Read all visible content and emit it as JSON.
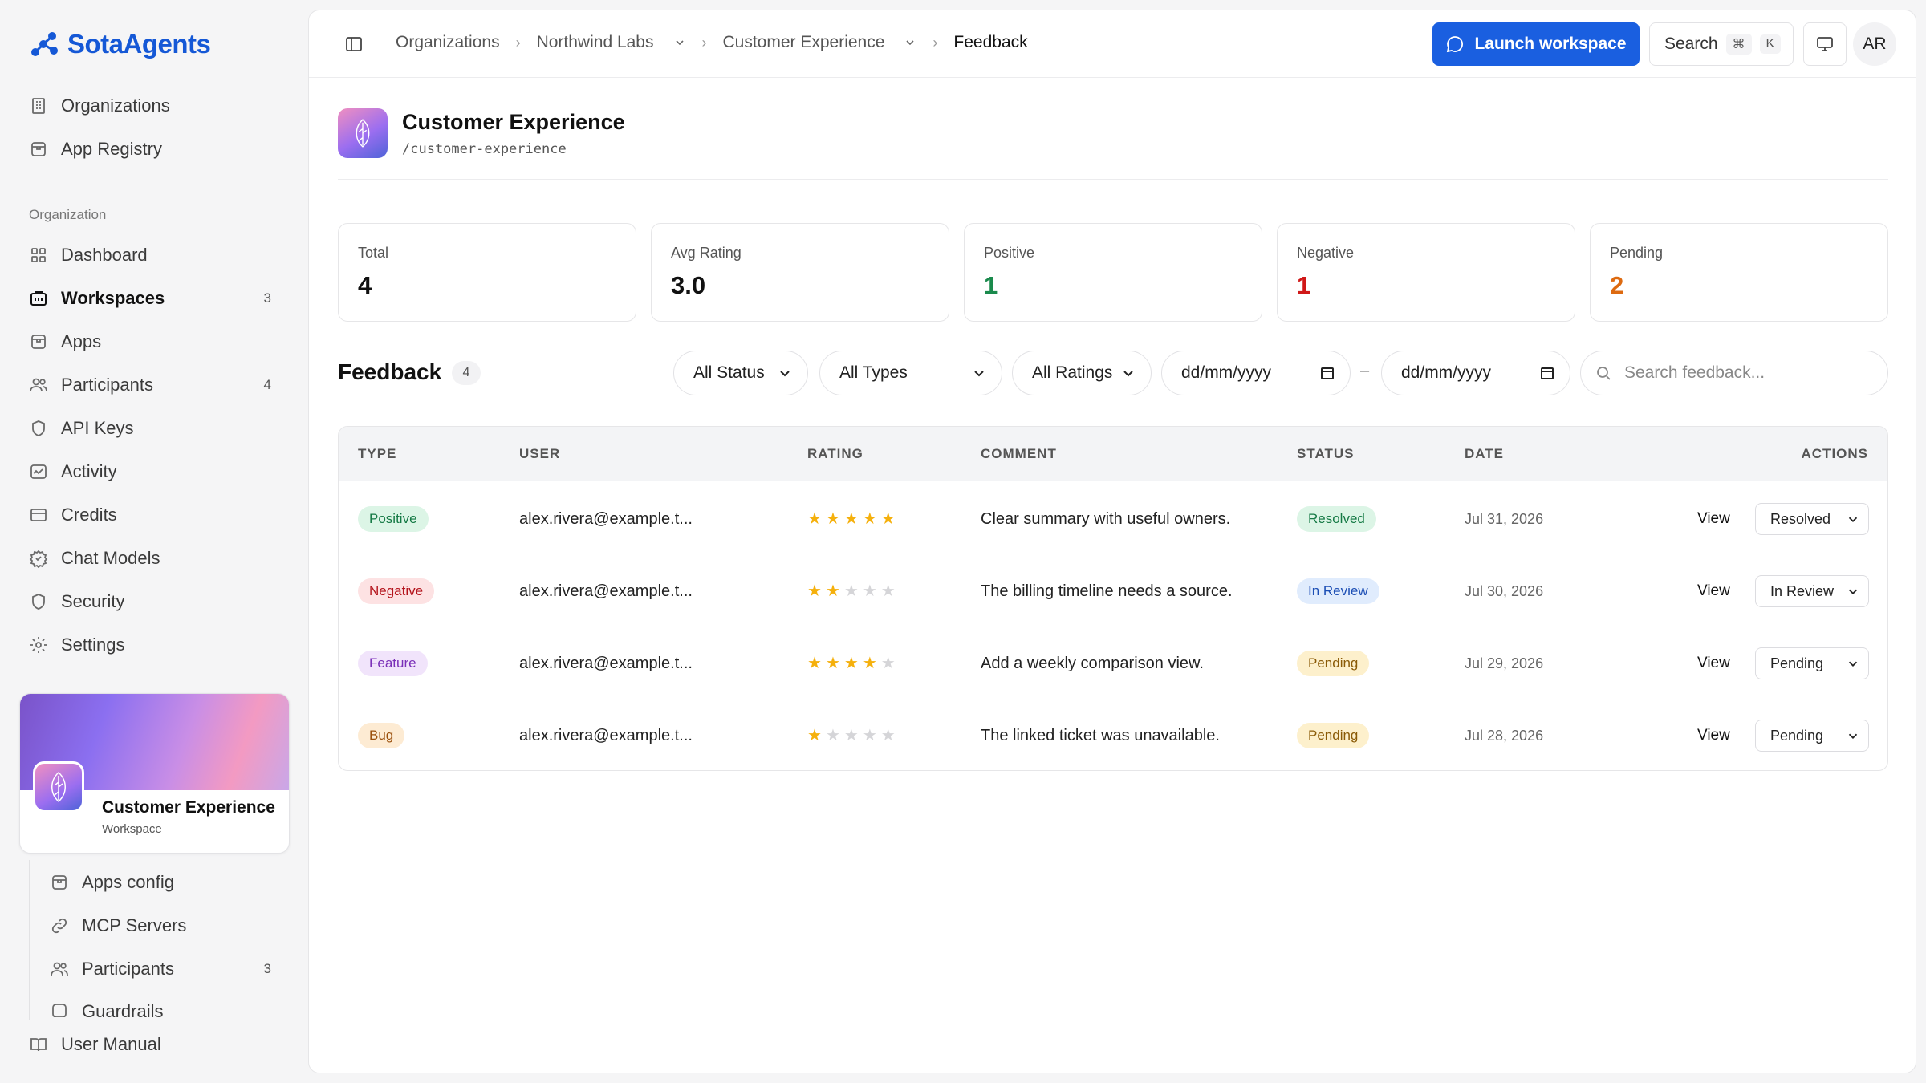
{
  "brand": {
    "name": "SotaAgents",
    "color": "#1558d6"
  },
  "sidebar": {
    "top_items": [
      {
        "label": "Organizations",
        "icon": "building-icon"
      },
      {
        "label": "App Registry",
        "icon": "package-icon"
      }
    ],
    "section_label": "Organization",
    "org_items": [
      {
        "label": "Dashboard",
        "icon": "grid-icon",
        "count": ""
      },
      {
        "label": "Workspaces",
        "icon": "briefcase-icon",
        "count": "3",
        "active": true
      },
      {
        "label": "Apps",
        "icon": "package-icon",
        "count": ""
      },
      {
        "label": "Participants",
        "icon": "users-icon",
        "count": "4"
      },
      {
        "label": "API Keys",
        "icon": "shield-icon",
        "count": ""
      },
      {
        "label": "Activity",
        "icon": "activity-icon",
        "count": ""
      },
      {
        "label": "Credits",
        "icon": "credit-card-icon",
        "count": ""
      },
      {
        "label": "Chat Models",
        "icon": "cpu-icon",
        "count": ""
      },
      {
        "label": "Security",
        "icon": "shield-icon",
        "count": ""
      },
      {
        "label": "Settings",
        "icon": "gear-icon",
        "count": ""
      }
    ],
    "workspace_card": {
      "name": "Customer Experience",
      "type": "Workspace"
    },
    "workspace_items": [
      {
        "label": "Apps config",
        "icon": "package-icon",
        "count": ""
      },
      {
        "label": "MCP Servers",
        "icon": "link-icon",
        "count": ""
      },
      {
        "label": "Participants",
        "icon": "users-icon",
        "count": "3"
      },
      {
        "label": "Guardrails",
        "icon": "shield-icon",
        "count": ""
      }
    ],
    "bottom_link": {
      "label": "User Manual",
      "icon": "book-icon"
    }
  },
  "topbar": {
    "breadcrumbs": [
      "Organizations",
      "Northwind Labs",
      "Customer Experience",
      "Feedback"
    ],
    "launch_label": "Launch workspace",
    "search_label": "Search",
    "search_kbd": [
      "⌘",
      "K"
    ],
    "avatar_initials": "AR",
    "accent": "#1a5fe0"
  },
  "workspace": {
    "title": "Customer Experience",
    "slug": "/customer-experience"
  },
  "stats": [
    {
      "label": "Total",
      "value": "4",
      "color": "#111111"
    },
    {
      "label": "Avg Rating",
      "value": "3.0",
      "color": "#111111"
    },
    {
      "label": "Positive",
      "value": "1",
      "color": "#1a8a4c"
    },
    {
      "label": "Negative",
      "value": "1",
      "color": "#d01818"
    },
    {
      "label": "Pending",
      "value": "2",
      "color": "#dd6a10"
    }
  ],
  "feedback": {
    "title": "Feedback",
    "count": "4",
    "filters": {
      "status": "All Status",
      "type": "All Types",
      "rating": "All Ratings",
      "date_from": "dd/mm/yyyy",
      "date_to": "dd/mm/yyyy",
      "search_placeholder": "Search feedback..."
    },
    "date_separator": "–",
    "columns": [
      "TYPE",
      "USER",
      "RATING",
      "COMMENT",
      "STATUS",
      "DATE",
      "ACTIONS"
    ],
    "rows": [
      {
        "type": "Positive",
        "type_bg": "#dcf5e6",
        "type_fg": "#157a45",
        "user": "alex.rivera@example.t...",
        "rating": 5,
        "comment": "Clear summary with useful owners.",
        "status": "Resolved",
        "status_bg": "#dcf5e6",
        "status_fg": "#157a45",
        "date": "Jul 31, 2026",
        "action": "View",
        "select": "Resolved"
      },
      {
        "type": "Negative",
        "type_bg": "#fde2e3",
        "type_fg": "#b4141c",
        "user": "alex.rivera@example.t...",
        "rating": 2,
        "comment": "The billing timeline needs a source.",
        "status": "In Review",
        "status_bg": "#e0ecfd",
        "status_fg": "#1d4fb5",
        "date": "Jul 30, 2026",
        "action": "View",
        "select": "In Review"
      },
      {
        "type": "Feature",
        "type_bg": "#f1e4fb",
        "type_fg": "#7a2fb8",
        "user": "alex.rivera@example.t...",
        "rating": 4,
        "comment": "Add a weekly comparison view.",
        "status": "Pending",
        "status_bg": "#fdf0cc",
        "status_fg": "#8a5a06",
        "date": "Jul 29, 2026",
        "action": "View",
        "select": "Pending"
      },
      {
        "type": "Bug",
        "type_bg": "#fdebd3",
        "type_fg": "#9a4f0b",
        "user": "alex.rivera@example.t...",
        "rating": 1,
        "comment": "The linked ticket was unavailable.",
        "status": "Pending",
        "status_bg": "#fdf0cc",
        "status_fg": "#8a5a06",
        "date": "Jul 28, 2026",
        "action": "View",
        "select": "Pending"
      }
    ]
  }
}
